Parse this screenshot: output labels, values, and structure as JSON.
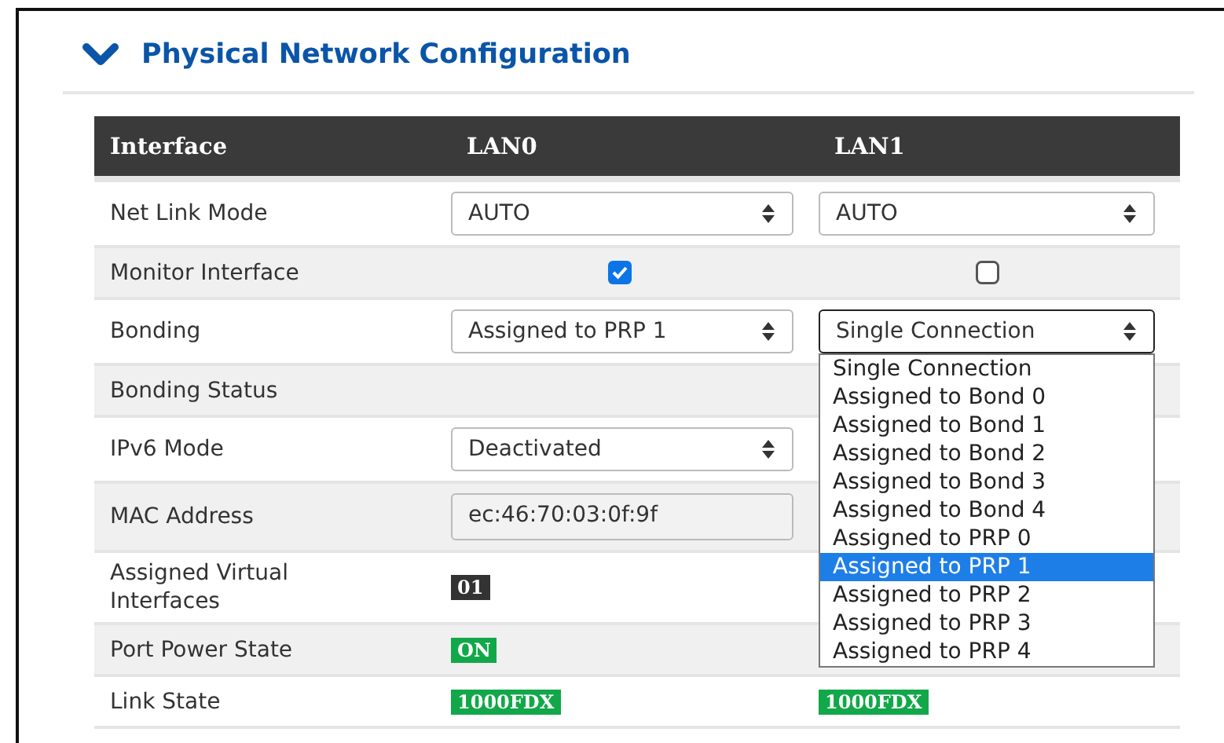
{
  "section": {
    "title": "Physical Network Configuration",
    "expanded": true
  },
  "table": {
    "columns": [
      "Interface",
      "LAN0",
      "LAN1"
    ],
    "rows": [
      {
        "cells": [
          {
            "kind": "label",
            "value": "Net Link Mode"
          },
          {
            "kind": "select",
            "value": "AUTO"
          },
          {
            "kind": "select",
            "value": "AUTO"
          }
        ]
      },
      {
        "cells": [
          {
            "kind": "label",
            "value": "Monitor Interface"
          },
          {
            "kind": "checkbox",
            "checked": true
          },
          {
            "kind": "checkbox",
            "checked": false
          }
        ]
      },
      {
        "cells": [
          {
            "kind": "label",
            "value": "Bonding"
          },
          {
            "kind": "select",
            "value": "Assigned to PRP 1"
          },
          {
            "kind": "select",
            "value": "Single Connection",
            "open": true
          }
        ]
      },
      {
        "cells": [
          {
            "kind": "label",
            "value": "Bonding Status"
          }
        ]
      },
      {
        "cells": [
          {
            "kind": "label",
            "value": "IPv6 Mode"
          },
          {
            "kind": "select",
            "value": "Deactivated"
          }
        ]
      },
      {
        "cells": [
          {
            "kind": "label",
            "value": "MAC Address"
          },
          {
            "kind": "field",
            "value": "ec:46:70:03:0f:9f"
          }
        ]
      },
      {
        "cells": [
          {
            "kind": "label",
            "value": "Assigned Virtual Interfaces"
          },
          {
            "kind": "badge",
            "value": "01",
            "color": "#333333"
          }
        ]
      },
      {
        "cells": [
          {
            "kind": "label",
            "value": "Port Power State"
          },
          {
            "kind": "badge",
            "value": "ON",
            "color": "#12a84a"
          }
        ]
      },
      {
        "cells": [
          {
            "kind": "label",
            "value": "Link State"
          },
          {
            "kind": "badge",
            "value": "1000FDX",
            "color": "#12a84a"
          },
          {
            "kind": "badge",
            "value": "1000FDX",
            "color": "#12a84a"
          }
        ]
      }
    ]
  },
  "dropdown": {
    "options": [
      {
        "label": "Single Connection",
        "selected": false
      },
      {
        "label": "Assigned to Bond 0",
        "selected": false
      },
      {
        "label": "Assigned to Bond 1",
        "selected": false
      },
      {
        "label": "Assigned to Bond 2",
        "selected": false
      },
      {
        "label": "Assigned to Bond 3",
        "selected": false
      },
      {
        "label": "Assigned to Bond 4",
        "selected": false
      },
      {
        "label": "Assigned to PRP 0",
        "selected": false
      },
      {
        "label": "Assigned to PRP 1",
        "selected": true
      },
      {
        "label": "Assigned to PRP 2",
        "selected": false
      },
      {
        "label": "Assigned to PRP 3",
        "selected": false
      },
      {
        "label": "Assigned to PRP 4",
        "selected": false
      }
    ]
  }
}
